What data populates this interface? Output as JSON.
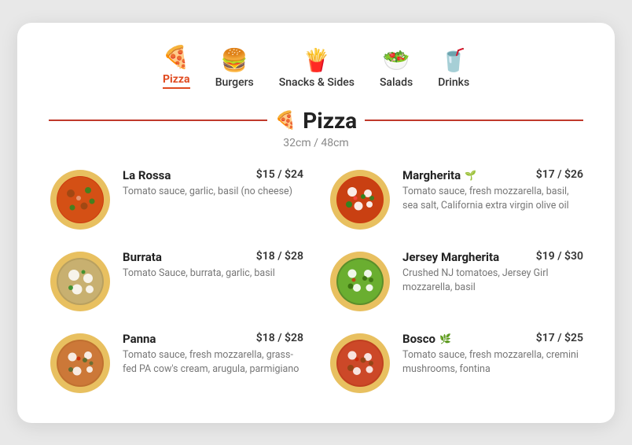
{
  "nav": {
    "items": [
      {
        "id": "pizza",
        "label": "Pizza",
        "icon": "🍕",
        "active": true
      },
      {
        "id": "burgers",
        "label": "Burgers",
        "icon": "🍔",
        "active": false
      },
      {
        "id": "snacks",
        "label": "Snacks & Sides",
        "icon": "🍟",
        "active": false
      },
      {
        "id": "salads",
        "label": "Salads",
        "icon": "🥗",
        "active": false
      },
      {
        "id": "drinks",
        "label": "Drinks",
        "icon": "🥤",
        "active": false
      }
    ]
  },
  "section": {
    "title": "Pizza",
    "subtitle": "32cm / 48cm"
  },
  "menu": [
    {
      "id": "la-rossa",
      "name": "La Rossa",
      "price": "$15 / $24",
      "description": "Tomato sauce, garlic, basil (no cheese)",
      "badge": "",
      "color": "#e07030",
      "col": 0
    },
    {
      "id": "margherita",
      "name": "Margherita",
      "price": "$17 / $26",
      "description": "Tomato sauce, fresh mozzarella, basil, sea salt, California extra virgin olive oil",
      "badge": "🌱",
      "color": "#d4a820",
      "col": 1
    },
    {
      "id": "burrata",
      "name": "Burrata",
      "price": "$18 / $28",
      "description": "Tomato Sauce, burrata, garlic, basil",
      "badge": "",
      "color": "#b8a060",
      "col": 0
    },
    {
      "id": "jersey-margherita",
      "name": "Jersey Margherita",
      "price": "$19 / $30",
      "description": "Crushed NJ tomatoes, Jersey Girl mozzarella, basil",
      "badge": "",
      "color": "#6a9e40",
      "col": 1
    },
    {
      "id": "panna",
      "name": "Panna",
      "price": "$18 / $28",
      "description": "Tomato sauce, fresh mozzarella, grass-fed PA cow's cream, arugula, parmigiano",
      "badge": "",
      "color": "#c07830",
      "col": 0
    },
    {
      "id": "bosco",
      "name": "Bosco",
      "price": "$17 / $25",
      "description": "Tomato sauce, fresh mozzarella, cremini mushrooms, fontina",
      "badge": "🌿",
      "color": "#c04020",
      "col": 1
    }
  ],
  "colors": {
    "accent": "#e04a1f"
  }
}
